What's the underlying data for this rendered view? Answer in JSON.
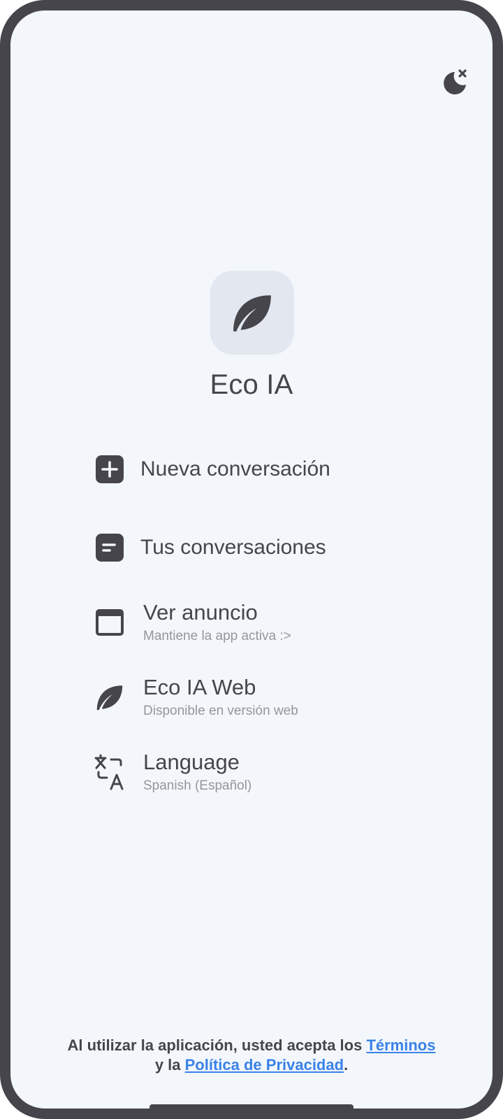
{
  "app": {
    "title": "Eco IA"
  },
  "header": {
    "theme_icon": "moon-stars-icon"
  },
  "logo": {
    "icon": "leaf-icon"
  },
  "menu": {
    "items": [
      {
        "label": "Nueva conversación",
        "icon": "add-box-icon"
      },
      {
        "label": "Tus conversaciones",
        "icon": "chat-icon"
      },
      {
        "label": "Ver anuncio",
        "subtitle": "Mantiene la app activa :>",
        "icon": "window-icon"
      },
      {
        "label": "Eco IA Web",
        "subtitle": "Disponible en versión web",
        "icon": "leaf-icon"
      },
      {
        "label": "Language",
        "subtitle": "Spanish (Español)",
        "icon": "translate-icon"
      }
    ]
  },
  "footer": {
    "text_before": "Al utilizar la aplicación, usted acepta los ",
    "terms_link": "Términos",
    "text_middle": "y la ",
    "privacy_link": "Política de Privacidad",
    "text_end": "."
  },
  "colors": {
    "frame": "#46454c",
    "background": "#f3f7fc",
    "logo_bg": "#e2e7f0",
    "link": "#3a82e8",
    "subtitle": "#96959b"
  }
}
